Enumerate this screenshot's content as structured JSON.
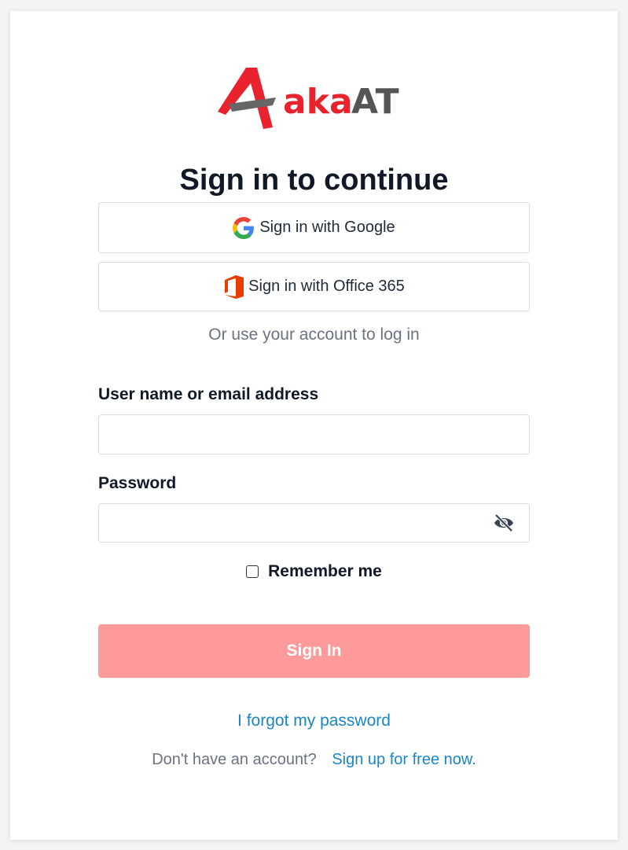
{
  "brand": {
    "name_part1": "aka",
    "name_part2": "AT",
    "colors": {
      "red": "#e8232e",
      "gray": "#555555"
    }
  },
  "page": {
    "title": "Sign in to continue"
  },
  "sso": {
    "google_label": "Sign in with Google",
    "google_icon": "google-logo-icon",
    "office_label": "Sign in with Office 365",
    "office_icon": "office-logo-icon"
  },
  "divider_text": "Or use your account to log in",
  "form": {
    "username_label": "User name or email address",
    "username_value": "",
    "password_label": "Password",
    "password_value": "",
    "password_toggle_icon": "eye-off-icon",
    "remember_label": "Remember me",
    "remember_checked": false,
    "submit_label": "Sign In",
    "submit_color": "#ff9a9a"
  },
  "links": {
    "forgot": "I forgot my password",
    "no_account": "Don't have an account?",
    "signup": "Sign up for free now.",
    "link_color": "#1a86c8"
  }
}
